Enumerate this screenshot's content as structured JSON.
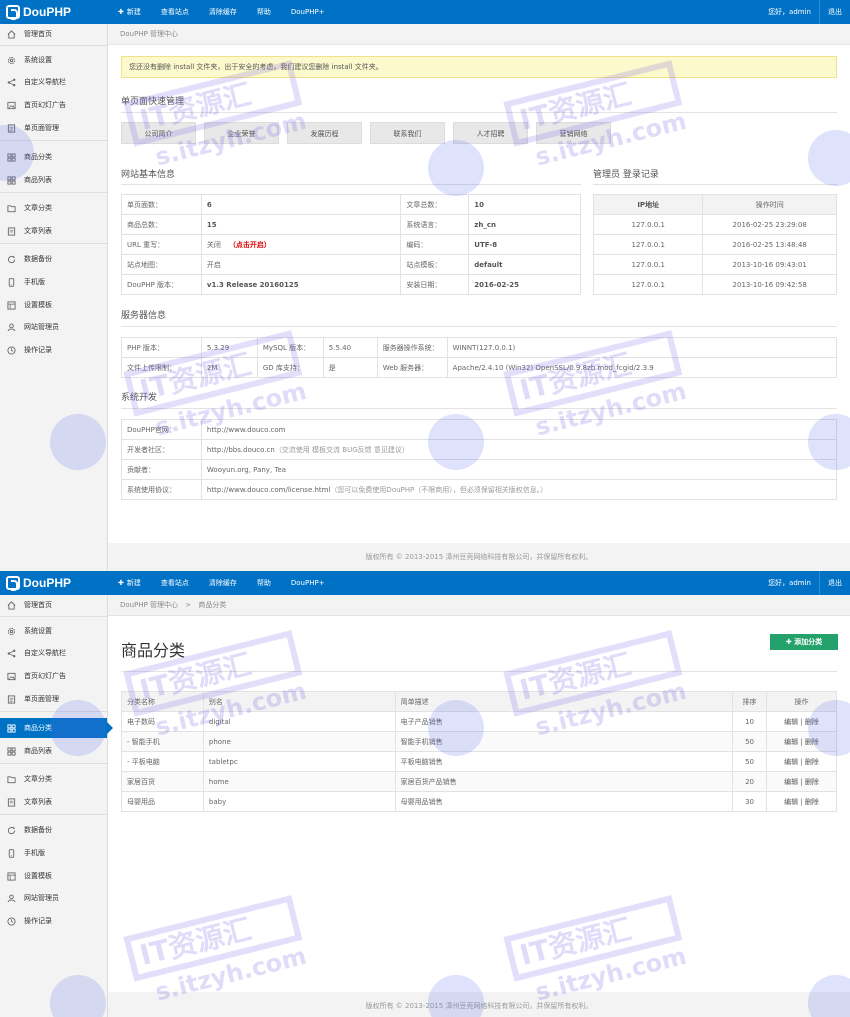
{
  "app": {
    "logo_text": "DouPHP",
    "nav": {
      "new": "新建",
      "view_site": "查看站点",
      "clear_cache": "清除缓存",
      "help": "帮助",
      "douphp_plus": "DouPHP+"
    },
    "greeting": "您好，admin",
    "logout": "退出",
    "footer": "版权所有 © 2013-2015 漳州豆壳网络科技有限公司，并保留所有权利。",
    "menu": {
      "home": "管理首页",
      "settings": "系统设置",
      "nav_bar": "自定义导航栏",
      "slides": "首页幻灯广告",
      "pages": "单页面管理",
      "product_cat": "商品分类",
      "product_list": "商品列表",
      "article_cat": "文章分类",
      "article_list": "文章列表",
      "backup": "数据备份",
      "mobile": "手机版",
      "theme": "设置模板",
      "admins": "网站管理员",
      "log": "操作记录"
    },
    "icons": {
      "home": "home-icon",
      "settings": "gear-icon",
      "nav": "share-icon",
      "slides": "image-icon",
      "pages": "page-icon",
      "cat": "grid-icon",
      "list": "list-icon",
      "backup": "refresh-icon",
      "mobile": "phone-icon",
      "theme": "template-icon",
      "admins": "user-icon",
      "log": "clock-icon"
    },
    "colors": {
      "topbar": "#0072c6",
      "active": "#0072c6",
      "add_button": "#23a26b",
      "notice_bg": "#fcf9cc"
    }
  },
  "dashboard": {
    "breadcrumb": "DouPHP 管理中心",
    "notice": "您还没有删除 install 文件夹，出于安全的考虑，我们建议您删除 install 文件夹。",
    "quick_title": "单页面快速管理",
    "quick_buttons": [
      "公司简介",
      "企业荣誉",
      "发展历程",
      "联系我们",
      "人才招聘",
      "营销网络"
    ],
    "site_info_title": "网站基本信息",
    "site_info": {
      "page_count_label": "单页面数：",
      "page_count": "6",
      "article_count_label": "文章总数：",
      "article_count": "10",
      "product_count_label": "商品总数：",
      "product_count": "15",
      "lang_label": "系统语言：",
      "lang": "zh_cn",
      "rewrite_label": "URL 重写：",
      "rewrite": "关闭",
      "rewrite_action": "（点击开启）",
      "charset_label": "编码：",
      "charset": "UTF-8",
      "sitemap_label": "站点地图：",
      "sitemap": "开启",
      "theme_label": "站点模板：",
      "theme": "default",
      "version_label": "DouPHP 版本：",
      "version": "v1.3 Release 20160125",
      "install_label": "安装日期：",
      "install_date": "2016-02-25"
    },
    "login_title": "管理员 登录记录",
    "login_headers": [
      "IP地址",
      "操作时间"
    ],
    "login_rows": [
      [
        "127.0.0.1",
        "2016-02-25 23:29:08"
      ],
      [
        "127.0.0.1",
        "2016-02-25 13:48:48"
      ],
      [
        "127.0.0.1",
        "2013-10-16 09:43:01"
      ],
      [
        "127.0.0.1",
        "2013-10-16 09:42:58"
      ]
    ],
    "server_title": "服务器信息",
    "server": {
      "php_label": "PHP 版本：",
      "php": "5.3.29",
      "mysql_label": "MySQL 版本：",
      "mysql": "5.5.40",
      "os_label": "服务器操作系统：",
      "os": "WINNT(127.0.0.1)",
      "upload_label": "文件上传限制：",
      "upload": "2M",
      "gd_label": "GD 库支持：",
      "gd": "是",
      "web_label": "Web 服务器：",
      "web": "Apache/2.4.10 (Win32) OpenSSL/0.9.8zb mod_fcgid/2.3.9"
    },
    "dev_title": "系统开发",
    "dev": {
      "site_label": "DouPHP官网：",
      "site": "http://www.douco.com",
      "community_label": "开发者社区：",
      "community": "http://bbs.douco.cn",
      "community_note": "（交流使用 模板交流 BUG反馈 意见建议）",
      "contrib_label": "贡献者：",
      "contrib": "Wooyun.org, Pany, Tea",
      "license_label": "系统使用协议：",
      "license": "http://www.douco.com/license.html",
      "license_note": "（您可以免费使用DouPHP（不限商用），但必须保留相关版权信息。）"
    }
  },
  "category_page": {
    "breadcrumb_home": "DouPHP 管理中心",
    "breadcrumb_sep": ">",
    "breadcrumb_current": "商品分类",
    "title": "商品分类",
    "add_button": "添加分类",
    "headers": [
      "分类名称",
      "别名",
      "简单描述",
      "排序",
      "操作"
    ],
    "rows": [
      {
        "name": "电子数码",
        "alias": "digital",
        "desc": "电子产品销售",
        "sort": "10"
      },
      {
        "name": "- 智能手机",
        "alias": "phone",
        "desc": "智能手机销售",
        "sort": "50"
      },
      {
        "name": "- 平板电脑",
        "alias": "tabletpc",
        "desc": "平板电脑销售",
        "sort": "50"
      },
      {
        "name": "家居百货",
        "alias": "home",
        "desc": "家居百货产品销售",
        "sort": "20"
      },
      {
        "name": "母婴用品",
        "alias": "baby",
        "desc": "母婴用品销售",
        "sort": "30"
      }
    ],
    "edit": "编辑",
    "op_sep": "|",
    "delete": "删除"
  },
  "watermark": {
    "line1": "IT资源汇",
    "line2": "s.itzyh.com"
  }
}
